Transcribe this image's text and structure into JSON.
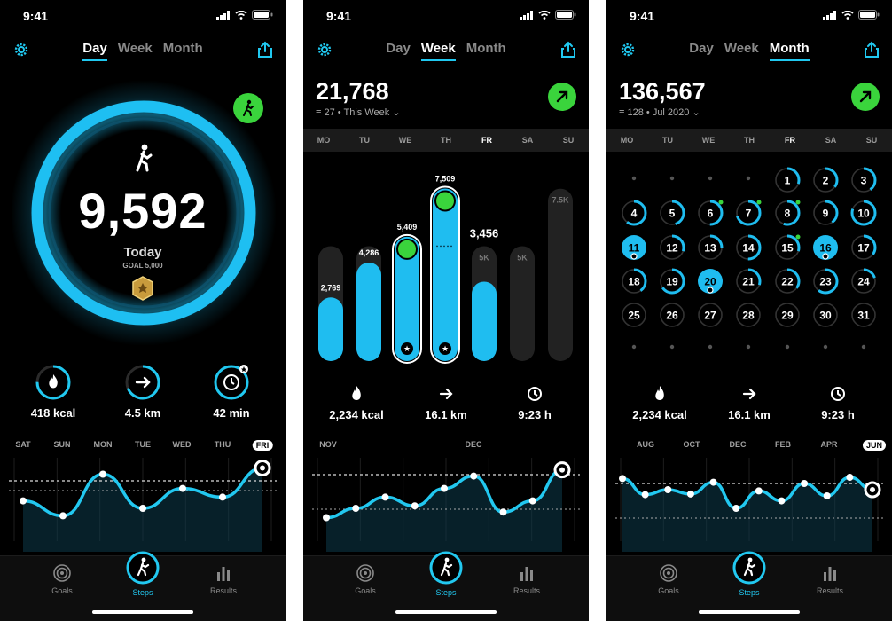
{
  "status": {
    "time": "9:41"
  },
  "tabs": {
    "goals": "Goals",
    "steps": "Steps",
    "results": "Results"
  },
  "day": {
    "segments": [
      "Day",
      "Week",
      "Month"
    ],
    "active": "Day",
    "steps": "9,592",
    "label": "Today",
    "goal": "GOAL 5,000",
    "ring_progress": 1.0,
    "stats": [
      {
        "icon": "flame-icon",
        "value": "418 kcal"
      },
      {
        "icon": "arrow-right-icon",
        "value": "4.5 km"
      },
      {
        "icon": "clock-icon",
        "value": "42 min"
      }
    ],
    "timeline": [
      "SAT",
      "SUN",
      "MON",
      "TUE",
      "WED",
      "THU",
      "FRI"
    ],
    "current": "FRI"
  },
  "week": {
    "segments": [
      "Day",
      "Week",
      "Month"
    ],
    "active": "Week",
    "total": "21,768",
    "count": "27",
    "period": "This Week",
    "days": [
      "MO",
      "TU",
      "WE",
      "TH",
      "FR",
      "SA",
      "SU"
    ],
    "current_day": "FR",
    "stats": [
      {
        "icon": "flame-icon",
        "value": "2,234 kcal"
      },
      {
        "icon": "arrow-right-icon",
        "value": "16.1 km"
      },
      {
        "icon": "clock-icon",
        "value": "9:23 h"
      }
    ],
    "timeline": [
      "NOV",
      "DEC"
    ]
  },
  "month": {
    "segments": [
      "Day",
      "Week",
      "Month"
    ],
    "active": "Month",
    "total": "136,567",
    "count": "128",
    "period": "Jul 2020",
    "days": [
      "MO",
      "TU",
      "WE",
      "TH",
      "FR",
      "SA",
      "SU"
    ],
    "current_day": "FR",
    "stats": [
      {
        "icon": "flame-icon",
        "value": "2,234 kcal"
      },
      {
        "icon": "arrow-right-icon",
        "value": "16.1 km"
      },
      {
        "icon": "clock-icon",
        "value": "9:23 h"
      }
    ],
    "timeline": [
      "AUG",
      "OCT",
      "DEC",
      "FEB",
      "APR",
      "JUN"
    ],
    "current": "JUN"
  },
  "chart_data": [
    {
      "type": "bar",
      "categories": [
        "MO",
        "TU",
        "WE",
        "TH",
        "FR",
        "SA",
        "SU"
      ],
      "values": [
        2769,
        4286,
        5409,
        7509,
        3456,
        0,
        0
      ],
      "labels": [
        "2,769",
        "4,286",
        "5,409",
        "7,509",
        "3,456",
        "",
        ""
      ],
      "goal_labels": [
        "",
        "",
        "",
        "",
        "5K",
        "5K",
        "7.5K"
      ],
      "goals": [
        5000,
        5000,
        5000,
        5000,
        5000,
        5000,
        7500
      ]
    },
    {
      "type": "line",
      "values": [
        0.42,
        0.18,
        0.85,
        0.3,
        0.62,
        0.48,
        0.95
      ]
    },
    {
      "type": "line",
      "values": [
        0.15,
        0.3,
        0.48,
        0.34,
        0.62,
        0.82,
        0.24,
        0.42,
        0.92
      ]
    },
    {
      "type": "line",
      "values": [
        0.78,
        0.52,
        0.6,
        0.53,
        0.72,
        0.3,
        0.58,
        0.42,
        0.7,
        0.5,
        0.8,
        0.6
      ]
    }
  ]
}
